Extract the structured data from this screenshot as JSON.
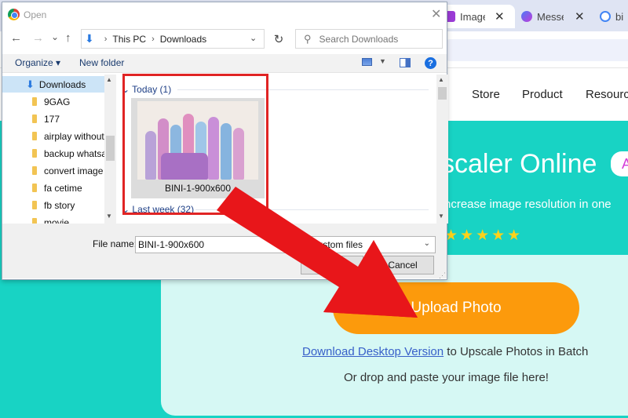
{
  "browser": {
    "tabs": [
      {
        "label": "Image",
        "color": "#9b3bd6",
        "active": true
      },
      {
        "label": "Messe",
        "color": "#b13bf0",
        "active": false
      },
      {
        "label": "bi",
        "color": "#4285f4",
        "active": false
      }
    ]
  },
  "site": {
    "nav": [
      "Store",
      "Product",
      "Resourc"
    ],
    "hero_title": "scaler Online",
    "ai_badge": "A",
    "hero_subtitle": "ncrease image resolution in one",
    "stars": "★★★★★",
    "rating_value": 5,
    "upload_button": "Upload Photo",
    "download_link": "Download Desktop Version",
    "download_suffix": " to Upscale Photos in Batch",
    "drop_text": "Or drop and paste your image file here!",
    "colors": {
      "hero": "#18d3c4",
      "button": "#fc9a0c",
      "panel": "#d6f8f4"
    }
  },
  "dialog": {
    "title": "Open",
    "close": "✕",
    "nav": {
      "back": "←",
      "forward": "→",
      "recent": "⌄",
      "up": "↑"
    },
    "breadcrumb": [
      "This PC",
      "Downloads"
    ],
    "refresh": "↻",
    "search_placeholder": "Search Downloads",
    "organize": "Organize ▾",
    "new_folder": "New folder",
    "help": "?",
    "tree": [
      "Downloads",
      "9GAG",
      "177",
      "airplay without",
      "backup whatsa",
      "convert image",
      "fa cetime",
      "fb story",
      "movie"
    ],
    "groups": {
      "today": "Today (1)",
      "last_week": "Last week (32)"
    },
    "file": {
      "name": "BINI-1-900x600"
    },
    "file_name_label": "File name:",
    "file_name_value": "BINI-1-900x600",
    "file_type": "Custom files",
    "open_button": "Open",
    "cancel_button": "Cancel"
  }
}
